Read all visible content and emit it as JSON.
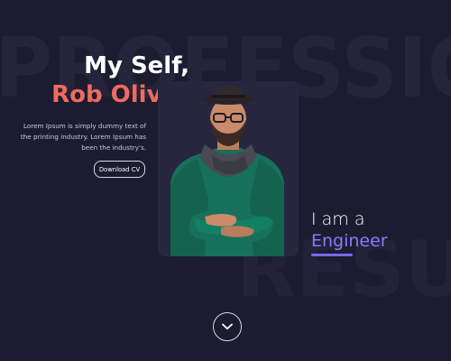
{
  "background": {
    "watermark_top": "PROFESSIONAL",
    "watermark_bottom": "RESU"
  },
  "hero": {
    "title_line1": "My Self,",
    "title_line2": "Rob Oliver",
    "description": "Lorem Ipsum is simply dummy text of the printing industry. Lorem Ipsum has been the industry's.",
    "download_label": "Download CV"
  },
  "tagline": {
    "line1": "I am a",
    "line2": "Engineer"
  },
  "colors": {
    "background": "#1c1c30",
    "accent_name": "#ee6b5e",
    "accent_role": "#8e77ff",
    "card": "#26263e"
  },
  "icons": {
    "scroll": "chevron-down-icon"
  }
}
